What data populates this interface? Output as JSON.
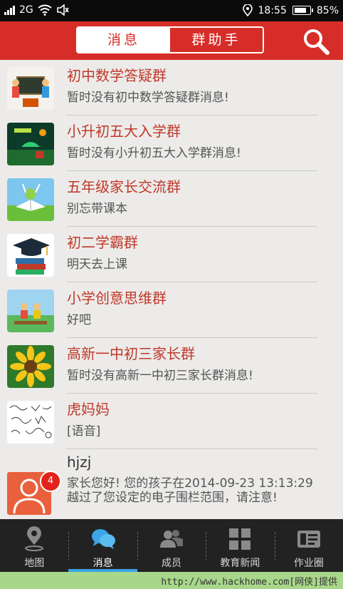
{
  "status_bar": {
    "network": "2G",
    "time": "18:55",
    "battery_percent": "85%",
    "battery_level": 0.85
  },
  "header": {
    "tabs": [
      {
        "label": "消息",
        "active": true
      },
      {
        "label": "群助手",
        "active": false
      }
    ],
    "search_icon": "search-icon"
  },
  "conversations": [
    {
      "name": "初中数学答疑群",
      "message": "暂时没有初中数学答疑群消息!"
    },
    {
      "name": "小升初五大入学群",
      "message": "暂时没有小升初五大入学群消息!"
    },
    {
      "name": "五年级家长交流群",
      "message": "别忘带课本"
    },
    {
      "name": "初二学霸群",
      "message": "明天去上课"
    },
    {
      "name": "小学创意思维群",
      "message": "好吧"
    },
    {
      "name": "高新一中初三家长群",
      "message": "暂时没有高新一中初三家长群消息!"
    },
    {
      "name": "虎妈妈",
      "message": "[语音]"
    },
    {
      "name": "hjzj",
      "message": "家长您好!  您的孩子在2014-09-23 13:13:29越过了您设定的电子围栏范围，请注意!",
      "badge": "4"
    }
  ],
  "bottom_nav": [
    {
      "label": "地图",
      "icon": "map-pin-icon",
      "active": false
    },
    {
      "label": "消息",
      "icon": "chat-bubbles-icon",
      "active": true
    },
    {
      "label": "成员",
      "icon": "members-icon",
      "active": false
    },
    {
      "label": "教育新闻",
      "icon": "news-grid-icon",
      "active": false
    },
    {
      "label": "作业圈",
      "icon": "homework-card-icon",
      "active": false
    }
  ],
  "watermark": "http://www.hackhome.com[网侠]提供",
  "colors": {
    "brand_red": "#d62d28",
    "title_red": "#c0392b",
    "active_blue": "#3ba5e6",
    "nav_bg": "#222222"
  }
}
